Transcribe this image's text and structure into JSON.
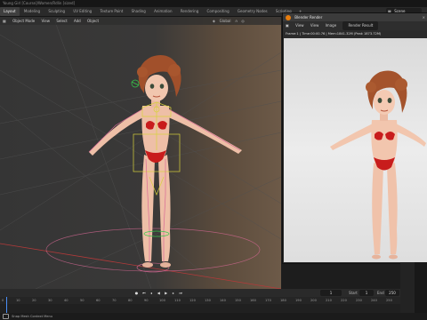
{
  "window": {
    "title": "Young Girl [Course]/Women/Rdlin [sized]"
  },
  "workspaces": {
    "tabs": [
      "Layout",
      "Modeling",
      "Sculpting",
      "UV Editing",
      "Texture Paint",
      "Shading",
      "Animation",
      "Rendering",
      "Compositing",
      "Geometry Nodes",
      "Scripting"
    ],
    "active": "Layout",
    "add": "+",
    "scene": "Scene"
  },
  "viewport": {
    "mode": "Object Mode",
    "menus": [
      "View",
      "Select",
      "Add",
      "Object"
    ],
    "transform": "Global"
  },
  "render_window": {
    "title": "Blender Render",
    "menus": [
      "View",
      "View",
      "Image"
    ],
    "slot": "Render Result",
    "status": "Frame:1 | Time:00:00.76 | Mem:1841.32M (Peak 1873.72M)"
  },
  "timeline": {
    "ruler": [
      "0",
      "10",
      "20",
      "30",
      "40",
      "50",
      "60",
      "70",
      "80",
      "90",
      "100",
      "110",
      "120",
      "130",
      "140",
      "150",
      "160",
      "170",
      "180",
      "190",
      "200",
      "210",
      "220",
      "230",
      "240",
      "250"
    ],
    "current_frame": "1",
    "start_label": "Start",
    "start_value": "1",
    "end_label": "End",
    "end_value": "250"
  },
  "status": {
    "text": "Snap Mesh Context Menu"
  },
  "colors": {
    "accent": "#4a8ff7",
    "skin": "#eebfa7",
    "bikini": "#c81c1c",
    "hair": "#a1502b",
    "bone_yellow": "#d7d23c",
    "bone_green": "#38c84b",
    "bone_pink": "#d86a96"
  },
  "icons": {
    "editor_type": "grid-icon",
    "transform_pivot": "pivot-icon",
    "snap": "magnet-icon",
    "play": "play-icon",
    "close": "close-icon"
  }
}
